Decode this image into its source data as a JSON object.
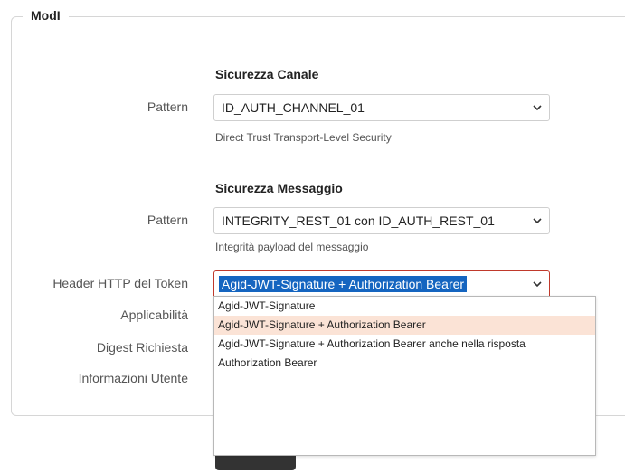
{
  "panel": {
    "legend": "ModI"
  },
  "canale": {
    "title": "Sicurezza Canale",
    "pattern_label": "Pattern",
    "pattern_value": "ID_AUTH_CHANNEL_01",
    "pattern_help": "Direct Trust Transport-Level Security"
  },
  "messaggio": {
    "title": "Sicurezza Messaggio",
    "pattern_label": "Pattern",
    "pattern_value": "INTEGRITY_REST_01 con ID_AUTH_REST_01",
    "pattern_help": "Integrità payload del messaggio",
    "header_label": "Header HTTP del Token",
    "header_value": "Agid-JWT-Signature + Authorization Bearer",
    "header_options": [
      "Agid-JWT-Signature",
      "Agid-JWT-Signature + Authorization Bearer",
      "Agid-JWT-Signature + Authorization Bearer anche nella risposta",
      "Authorization Bearer"
    ],
    "applicabilita_label": "Applicabilità",
    "digest_label": "Digest Richiesta",
    "info_utente_label": "Informazioni Utente"
  },
  "icons": {
    "select_arrow": "chevron-down-icon"
  },
  "colors": {
    "selection": "#1565c0",
    "hover": "#fbe3d6",
    "focus_border": "#c0392b"
  }
}
